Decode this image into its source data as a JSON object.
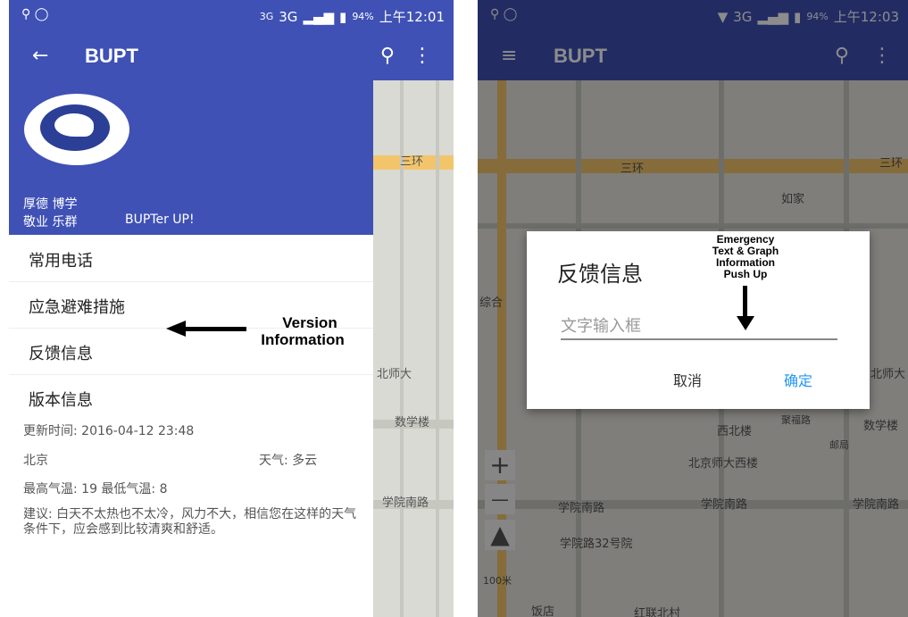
{
  "left": {
    "status": {
      "left_icons": "⚲ ◯",
      "network_small": "3G",
      "network": "3G",
      "battery": "94%",
      "time": "上午12:01"
    },
    "appbar": {
      "title": "BUPT"
    },
    "drawer": {
      "slogan_line1": "厚德 博学",
      "slogan_line2": "敬业 乐群",
      "slogan_tag": "BUPTer UP!",
      "menu": [
        "常用电话",
        "应急避难措施",
        "反馈信息",
        "版本信息"
      ],
      "update_time": "更新时间: 2016-04-12 23:48",
      "city": "北京",
      "weather": "天气: 多云",
      "temps": "最高气温: 19 最低气温: 8",
      "advice": "建议: 白天不太热也不太冷，风力不大，相信您在这样的天气条件下，应会感到比较清爽和舒适。"
    },
    "map_labels": [
      "三环",
      "北师大",
      "数学楼",
      "学院南路"
    ],
    "annotation": {
      "line1": "Version",
      "line2": "Information"
    }
  },
  "right": {
    "status": {
      "left_icons": "⚲ ◯",
      "network": "3G",
      "battery": "94%",
      "time": "上午12:03"
    },
    "appbar": {
      "title": "BUPT"
    },
    "map_labels": [
      "三环",
      "三环",
      "如家",
      "综合",
      "北师大",
      "数学楼",
      "西北楼",
      "北京师大西楼",
      "学院南路",
      "学院南路",
      "学院南路",
      "学院路32号院",
      "100米",
      "红联北村",
      "饭店",
      "邮局",
      "聚福路"
    ],
    "dialog": {
      "title": "反馈信息",
      "placeholder": "文字输入框",
      "cancel": "取消",
      "confirm": "确定"
    },
    "annotation": {
      "line1": "Emergency",
      "line2": "Text & Graph",
      "line3": "Information",
      "line4": "Push Up"
    },
    "zoom_in": "+",
    "zoom_out": "—",
    "compass": "▲"
  },
  "colors": {
    "primary": "#3f51b5",
    "accent": "#2196f3"
  }
}
